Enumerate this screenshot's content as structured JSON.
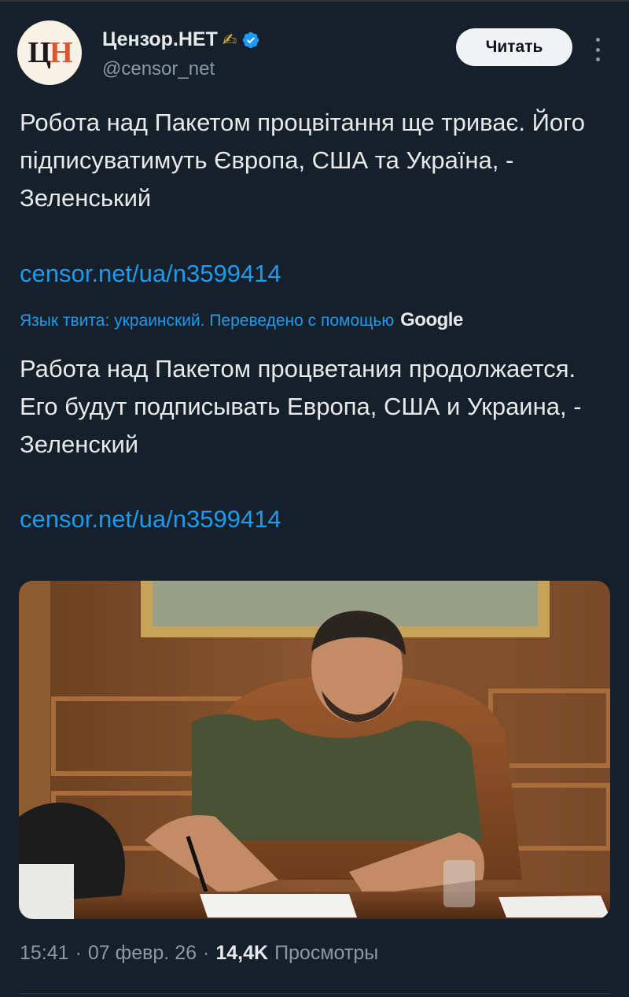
{
  "account": {
    "display_name": "Цензор.НЕТ",
    "name_emoji": "✍",
    "handle": "@censor_net",
    "avatar_text_c": "Ц",
    "avatar_text_n": "Н"
  },
  "follow_label": "Читать",
  "tweet": {
    "text": "Робота над Пакетом процвітання ще триває. Його підписуватимуть Європа, США та Україна, - Зеленський",
    "link": "censor.net/ua/n3599414"
  },
  "translation": {
    "note": "Язык твита: украинский. Переведено с помощью",
    "provider": "Google",
    "text": "Работа над Пакетом процветания продолжается. Его будут подписывать Европа, США и Украина, - Зеленский",
    "link": "censor.net/ua/n3599414"
  },
  "meta": {
    "time": "15:41",
    "separator": "·",
    "date": "07 февр. 26",
    "views_count": "14,4K",
    "views_label": "Просмотры"
  },
  "colors": {
    "background": "#15202b",
    "accent": "#1d9bf0",
    "secondary_text": "#8b98a5"
  },
  "icons": [
    "verified-badge-icon",
    "more-options-icon"
  ]
}
